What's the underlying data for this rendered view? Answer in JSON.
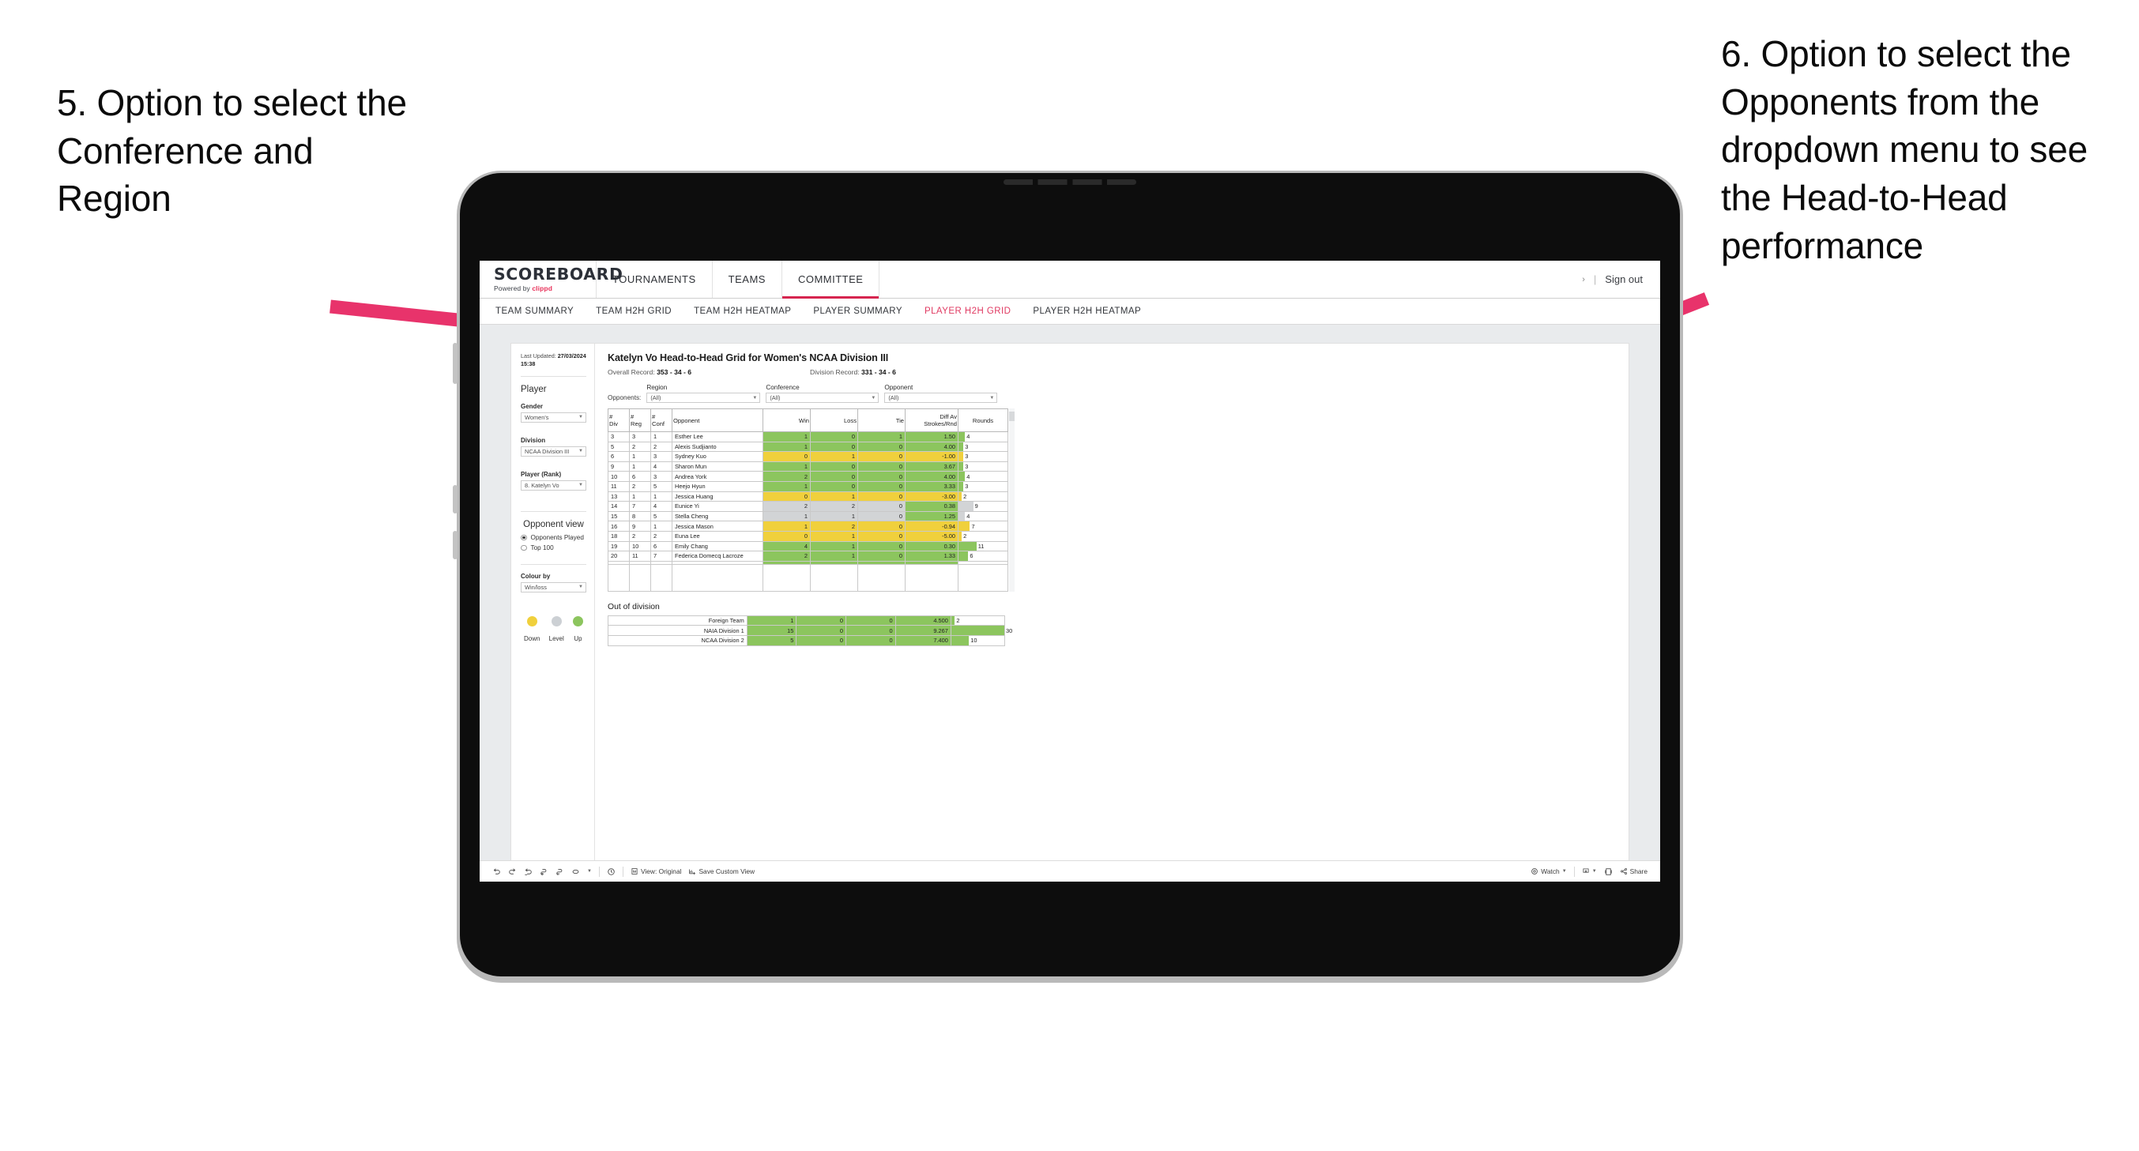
{
  "annotations": {
    "left": "5. Option to select the Conference and Region",
    "right": "6. Option to select the Opponents from the dropdown menu to see the Head-to-Head performance"
  },
  "navbar": {
    "logo_main": "SCOREBOARD",
    "logo_sub_prefix": "Powered by ",
    "logo_sub_brand": "clippd",
    "items": [
      {
        "label": "TOURNAMENTS",
        "active": false
      },
      {
        "label": "TEAMS",
        "active": false
      },
      {
        "label": "COMMITTEE",
        "active": true
      }
    ],
    "chevron": "›",
    "separator": "|",
    "sign_out": "Sign out"
  },
  "subnav": {
    "items": [
      {
        "label": "TEAM SUMMARY",
        "active": false
      },
      {
        "label": "TEAM H2H GRID",
        "active": false
      },
      {
        "label": "TEAM H2H HEATMAP",
        "active": false
      },
      {
        "label": "PLAYER SUMMARY",
        "active": false
      },
      {
        "label": "PLAYER H2H GRID",
        "active": true
      },
      {
        "label": "PLAYER H2H HEATMAP",
        "active": false
      }
    ]
  },
  "filters": {
    "last_updated_label": "Last Updated:",
    "last_updated_date": "27/03/2024",
    "last_updated_time": "15:38",
    "player_title": "Player",
    "gender_label": "Gender",
    "gender_value": "Women's",
    "division_label": "Division",
    "division_value": "NCAA Division III",
    "player_rank_label": "Player (Rank)",
    "player_rank_value": "8. Katelyn Vo",
    "opponent_view_title": "Opponent view",
    "opponent_view_options": [
      {
        "label": "Opponents Played",
        "selected": true
      },
      {
        "label": "Top 100",
        "selected": false
      }
    ],
    "colour_by_label": "Colour by",
    "colour_by_value": "Win/loss",
    "legend": [
      {
        "label": "Down",
        "color": "#f0d03c"
      },
      {
        "label": "Level",
        "color": "#ccd0d4"
      },
      {
        "label": "Up",
        "color": "#8cc55e"
      }
    ]
  },
  "viz": {
    "title": "Katelyn Vo Head-to-Head Grid for Women's NCAA Division III",
    "overall_record_label": "Overall Record:",
    "overall_record_value": "353 - 34 - 6",
    "division_record_label": "Division Record:",
    "division_record_value": "331 - 34 - 6",
    "opponents_label": "Opponents:",
    "region_label": "Region",
    "region_value": "(All)",
    "conference_label": "Conference",
    "conference_value": "(All)",
    "opponent_label": "Opponent",
    "opponent_value": "(All)"
  },
  "chart_data": {
    "type": "table",
    "title": "Katelyn Vo Head-to-Head Grid for Women's NCAA Division III",
    "columns": [
      "# Div",
      "# Reg",
      "# Conf",
      "Opponent",
      "Win",
      "Loss",
      "Tie",
      "Diff Av Strokes/Rnd",
      "Rounds"
    ],
    "header_lines": [
      [
        "#",
        "Div"
      ],
      [
        "#",
        "Reg"
      ],
      [
        "#",
        "Conf"
      ],
      [
        "",
        "Opponent"
      ],
      [
        "",
        "Win"
      ],
      [
        "",
        "Loss"
      ],
      [
        "",
        "Tie"
      ],
      [
        "Diff Av",
        "Strokes/Rnd"
      ],
      [
        "",
        "Rounds"
      ]
    ],
    "rounds_max": 30,
    "rows": [
      {
        "div": "3",
        "reg": "3",
        "conf": "1",
        "opponent": "Esther Lee",
        "win": "1",
        "loss": "0",
        "tie": "1",
        "diff": "1.50",
        "rounds": 4,
        "state": "up"
      },
      {
        "div": "5",
        "reg": "2",
        "conf": "2",
        "opponent": "Alexis Sudjianto",
        "win": "1",
        "loss": "0",
        "tie": "0",
        "diff": "4.00",
        "rounds": 3,
        "state": "up"
      },
      {
        "div": "6",
        "reg": "1",
        "conf": "3",
        "opponent": "Sydney Kuo",
        "win": "0",
        "loss": "1",
        "tie": "0",
        "diff": "-1.00",
        "rounds": 3,
        "state": "down"
      },
      {
        "div": "9",
        "reg": "1",
        "conf": "4",
        "opponent": "Sharon Mun",
        "win": "1",
        "loss": "0",
        "tie": "0",
        "diff": "3.67",
        "rounds": 3,
        "state": "up"
      },
      {
        "div": "10",
        "reg": "6",
        "conf": "3",
        "opponent": "Andrea York",
        "win": "2",
        "loss": "0",
        "tie": "0",
        "diff": "4.00",
        "rounds": 4,
        "state": "up"
      },
      {
        "div": "11",
        "reg": "2",
        "conf": "5",
        "opponent": "Heejo Hyun",
        "win": "1",
        "loss": "0",
        "tie": "0",
        "diff": "3.33",
        "rounds": 3,
        "state": "up"
      },
      {
        "div": "13",
        "reg": "1",
        "conf": "1",
        "opponent": "Jessica Huang",
        "win": "0",
        "loss": "1",
        "tie": "0",
        "diff": "-3.00",
        "rounds": 2,
        "state": "down"
      },
      {
        "div": "14",
        "reg": "7",
        "conf": "4",
        "opponent": "Eunice Yi",
        "win": "2",
        "loss": "2",
        "tie": "0",
        "diff": "0.38",
        "rounds": 9,
        "state": "level",
        "diff_state": "up"
      },
      {
        "div": "15",
        "reg": "8",
        "conf": "5",
        "opponent": "Stella Cheng",
        "win": "1",
        "loss": "1",
        "tie": "0",
        "diff": "1.25",
        "rounds": 4,
        "state": "level",
        "diff_state": "up"
      },
      {
        "div": "16",
        "reg": "9",
        "conf": "1",
        "opponent": "Jessica Mason",
        "win": "1",
        "loss": "2",
        "tie": "0",
        "diff": "-0.94",
        "rounds": 7,
        "state": "down"
      },
      {
        "div": "18",
        "reg": "2",
        "conf": "2",
        "opponent": "Euna Lee",
        "win": "0",
        "loss": "1",
        "tie": "0",
        "diff": "-5.00",
        "rounds": 2,
        "state": "down"
      },
      {
        "div": "19",
        "reg": "10",
        "conf": "6",
        "opponent": "Emily Chang",
        "win": "4",
        "loss": "1",
        "tie": "0",
        "diff": "0.30",
        "rounds": 11,
        "state": "up"
      },
      {
        "div": "20",
        "reg": "11",
        "conf": "7",
        "opponent": "Federica Domecq Lacroze",
        "win": "2",
        "loss": "1",
        "tie": "0",
        "diff": "1.33",
        "rounds": 6,
        "state": "up"
      }
    ],
    "out_of_division": {
      "title": "Out of division",
      "rows": [
        {
          "opponent": "Foreign Team",
          "win": "1",
          "loss": "0",
          "tie": "0",
          "diff": "4.500",
          "rounds": 2,
          "state": "up"
        },
        {
          "opponent": "NAIA Division 1",
          "win": "15",
          "loss": "0",
          "tie": "0",
          "diff": "9.267",
          "rounds": 30,
          "state": "up"
        },
        {
          "opponent": "NCAA Division 2",
          "win": "5",
          "loss": "0",
          "tie": "0",
          "diff": "7.400",
          "rounds": 10,
          "state": "up"
        }
      ]
    }
  },
  "toolbar": {
    "view_original": "View: Original",
    "save_custom_view": "Save Custom View",
    "watch": "Watch",
    "share": "Share"
  }
}
